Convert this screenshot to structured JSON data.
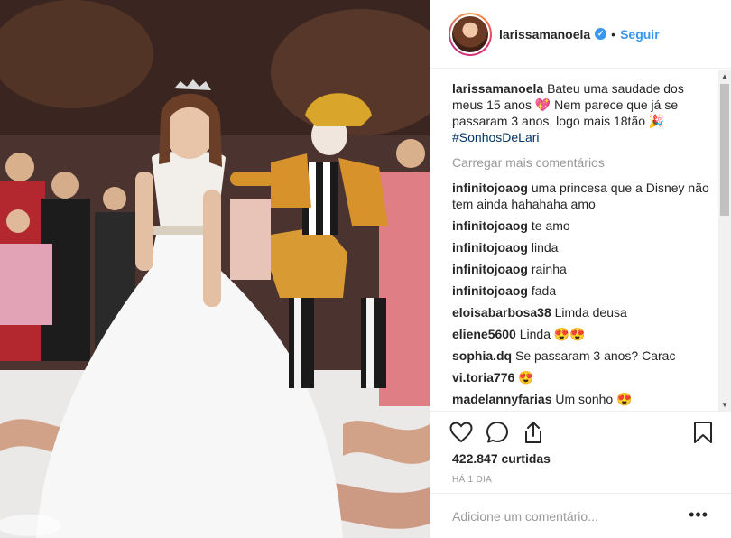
{
  "post": {
    "username": "larissamanoela",
    "follow_label": "Seguir",
    "separator": "•",
    "verified_mark": "✓"
  },
  "caption": {
    "username": "larissamanoela",
    "text": "Bateu uma saudade dos meus 15 anos 💖 Nem parece que já se passaram 3 anos, logo mais 18tão 🎉",
    "hashtag": "#SonhosDeLari"
  },
  "load_more_label": "Carregar mais comentários",
  "comments": [
    {
      "username": "infinitojoaog",
      "text": "uma princesa que a Disney não tem ainda hahahaha amo"
    },
    {
      "username": "infinitojoaog",
      "text": "te amo"
    },
    {
      "username": "infinitojoaog",
      "text": "linda"
    },
    {
      "username": "infinitojoaog",
      "text": "rainha"
    },
    {
      "username": "infinitojoaog",
      "text": "fada"
    },
    {
      "username": "eloisabarbosa38",
      "text": "Limda deusa"
    },
    {
      "username": "eliene5600",
      "text": "Linda 😍😍"
    },
    {
      "username": "sophia.dq",
      "text": "Se passaram 3 anos? Carac"
    },
    {
      "username": "vi.toria776",
      "text": "😍"
    },
    {
      "username": "madelannyfarias",
      "text": "Um sonho 😍"
    }
  ],
  "likes": {
    "count": "422.847",
    "label": "curtidas"
  },
  "date": "HÁ 1 DIA",
  "add_comment": {
    "placeholder": "Adicione um comentário..."
  },
  "more_label": "•••",
  "icons": {
    "like": "heart-icon",
    "comment": "comment-icon",
    "share": "share-icon",
    "save": "bookmark-icon",
    "verified": "verified-badge-icon"
  },
  "colors": {
    "link": "#3897f0",
    "hashtag": "#003569",
    "muted": "#999999",
    "text": "#262626"
  }
}
